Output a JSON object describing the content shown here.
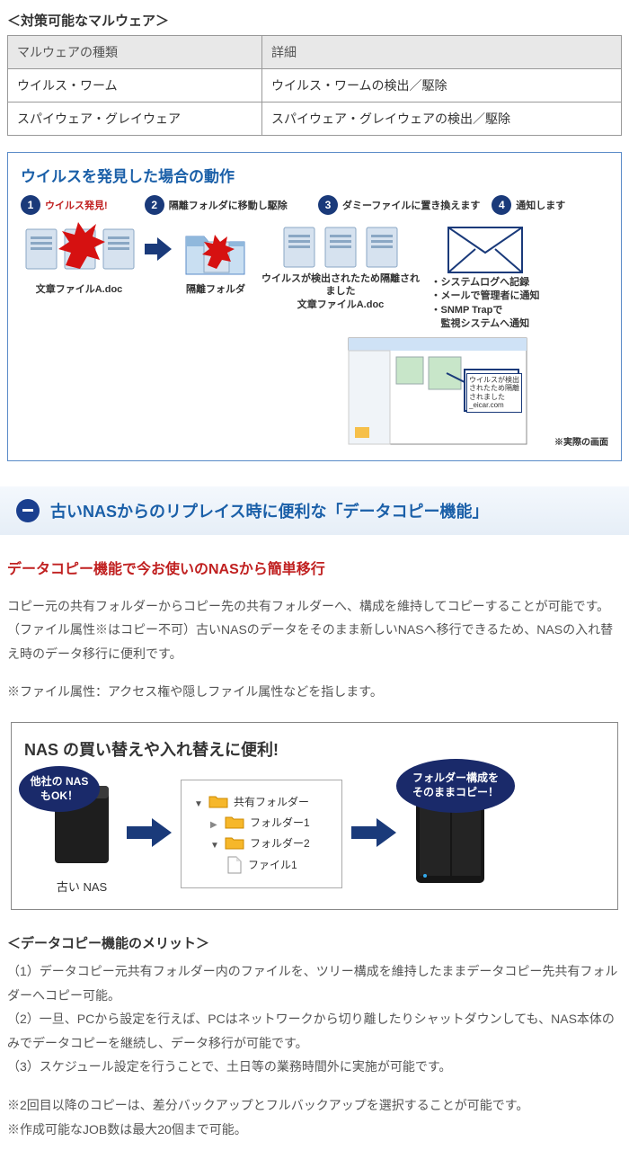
{
  "table_title": "＜対策可能なマルウェア＞",
  "table": {
    "header": [
      "マルウェアの種類",
      "詳細"
    ],
    "rows": [
      [
        "ウイルス・ワーム",
        "ウイルス・ワームの検出／駆除"
      ],
      [
        "スパイウェア・グレイウェア",
        "スパイウェア・グレイウェアの検出／駆除"
      ]
    ]
  },
  "virus": {
    "title": "ウイルスを発見した場合の動作",
    "steps": [
      {
        "num": "1",
        "label": "ウイルス発見!",
        "red": true
      },
      {
        "num": "2",
        "label": "隔離フォルダに移動し駆除"
      },
      {
        "num": "3",
        "label": "ダミーファイルに置き換えます"
      },
      {
        "num": "4",
        "label": "通知します"
      }
    ],
    "col1_caption": "文章ファイルA.doc",
    "col2_caption": "隔離フォルダ",
    "col3_caption_line1": "ウイルスが検出されたため隔離されました",
    "col3_caption_line2": "文章ファイルA.doc",
    "popup_text": "ウイルスが検出されたため隔離されました _eicar.com",
    "notify": [
      "・システムログへ記録",
      "・メールで管理者に通知",
      "・SNMP Trapで",
      "　監視システムへ通知"
    ],
    "screenshot_caption": "※実際の画面"
  },
  "collapse": {
    "title": "古いNASからのリプレイス時に便利な「データコピー機能」"
  },
  "sub_heading": "データコピー機能で今お使いのNASから簡単移行",
  "body_p1": "コピー元の共有フォルダーからコピー先の共有フォルダーへ、構成を維持してコピーすることが可能です。（ファイル属性※はコピー不可）古いNASのデータをそのまま新しいNASへ移行できるため、NASの入れ替え時のデータ移行に便利です。",
  "body_p2": "※ファイル属性：アクセス権や隠しファイル属性などを指します。",
  "diagram": {
    "title": "NAS の買い替えや入れ替えに便利!",
    "badge_left_l1": "他社の NAS",
    "badge_left_l2": "もOK！",
    "nas_old_label": "古い NAS",
    "folders": {
      "root": "共有フォルダー",
      "f1": "フォルダー1",
      "f2": "フォルダー2",
      "file1": "ファイル1"
    },
    "badge_right_l1": "フォルダー構成を",
    "badge_right_l2": "そのままコピー！"
  },
  "merits": {
    "title": "＜データコピー機能のメリット＞",
    "items": [
      "（1）データコピー元共有フォルダー内のファイルを、ツリー構成を維持したままデータコピー先共有フォルダーへコピー可能。",
      "（2）一旦、PCから設定を行えば、PCはネットワークから切り離したりシャットダウンしても、NAS本体のみでデータコピーを継続し、データ移行が可能です。",
      "（3）スケジュール設定を行うことで、土日等の業務時間外に実施が可能です。"
    ]
  },
  "footnotes": [
    "※2回目以降のコピーは、差分バックアップとフルバックアップを選択することが可能です。",
    "※作成可能なJOB数は最大20個まで可能。"
  ]
}
